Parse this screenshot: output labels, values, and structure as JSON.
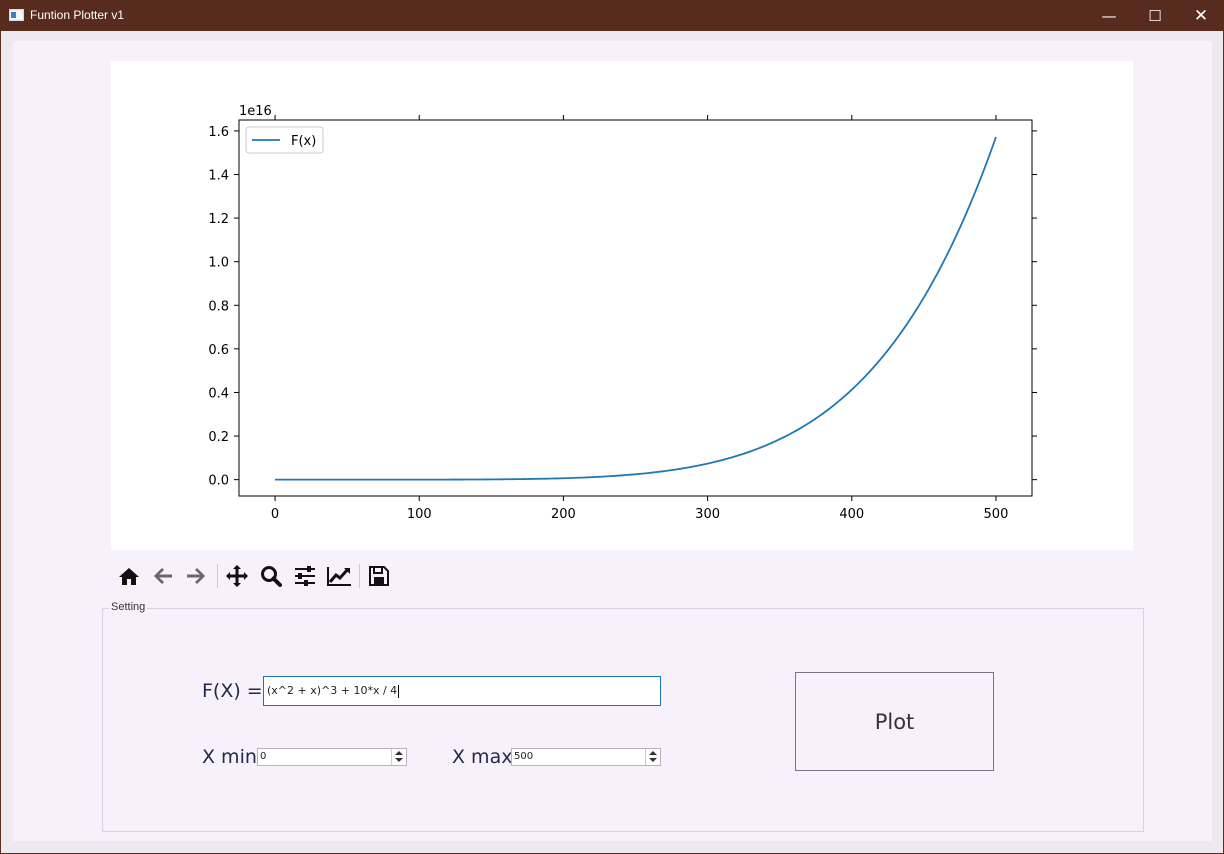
{
  "window": {
    "title": "Funtion Plotter v1"
  },
  "chart_data": {
    "type": "line",
    "title": "",
    "xlabel": "",
    "ylabel": "",
    "offset_label": "1e16",
    "xlim": [
      -25,
      525
    ],
    "ylim": [
      -0.075,
      1.65
    ],
    "x_ticks": [
      0,
      100,
      200,
      300,
      400,
      500
    ],
    "y_ticks": [
      0.0,
      0.2,
      0.4,
      0.6,
      0.8,
      1.0,
      1.2,
      1.4,
      1.6
    ],
    "y_tick_labels": [
      "0.0",
      "0.2",
      "0.4",
      "0.6",
      "0.8",
      "1.0",
      "1.2",
      "1.4",
      "1.6"
    ],
    "x_tick_labels": [
      "0",
      "100",
      "200",
      "300",
      "400",
      "500"
    ],
    "series": [
      {
        "name": "F(x)",
        "color": "#1f77b4",
        "expression": "(x^2 + x)^3 + 10*x / 4",
        "x_range": [
          0,
          500
        ],
        "y_scale_note": "values in units of 1e16"
      }
    ],
    "legend": {
      "placement": "top-left",
      "entries": [
        "F(x)"
      ]
    },
    "grid": false
  },
  "toolbar": {
    "items": [
      "home-icon",
      "back-arrow-icon",
      "forward-arrow-icon",
      "pan-icon",
      "zoom-icon",
      "configure-subplots-icon",
      "edit-axis-icon",
      "save-icon"
    ]
  },
  "settings": {
    "group_title": "Setting",
    "fx_label": "F(X) =",
    "fx_value": "(x^2 + x)^3 + 10*x / 4",
    "xmin_label": "X min",
    "xmin_value": "0",
    "xmax_label": "X max",
    "xmax_value": "500",
    "plot_button": "Plot"
  }
}
